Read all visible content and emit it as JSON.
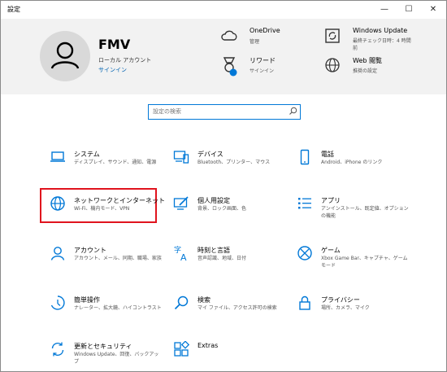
{
  "window": {
    "title": "設定",
    "minimize": "—",
    "maximize": "☐",
    "close": "✕"
  },
  "account": {
    "name": "FMV",
    "type": "ローカル アカウント",
    "signin": "サインイン"
  },
  "header_items": [
    {
      "name": "OneDrive",
      "desc": "管理",
      "icon": "cloud-icon"
    },
    {
      "name": "Windows Update",
      "desc": "最終チェック日時：4 時間前",
      "icon": "update-icon"
    },
    {
      "name": "リワード",
      "desc": "サインイン",
      "icon": "rewards-icon"
    },
    {
      "name": "Web 閲覧",
      "desc": "推奨の設定",
      "icon": "globe-icon"
    }
  ],
  "search": {
    "placeholder": "設定の検索"
  },
  "tiles": [
    {
      "name": "システム",
      "desc": "ディスプレイ、サウンド、通知、電源",
      "icon": "laptop-icon"
    },
    {
      "name": "デバイス",
      "desc": "Bluetooth、プリンター、マウス",
      "icon": "devices-icon"
    },
    {
      "name": "電話",
      "desc": "Android、iPhone のリンク",
      "icon": "phone-icon"
    },
    {
      "name": "ネットワークとインターネット",
      "desc": "Wi-Fi、機内モード、VPN",
      "icon": "globe-icon"
    },
    {
      "name": "個人用設定",
      "desc": "背景、ロック画面、色",
      "icon": "personalization-icon"
    },
    {
      "name": "アプリ",
      "desc": "アンインストール、既定値、オプションの機能",
      "icon": "apps-icon"
    },
    {
      "name": "アカウント",
      "desc": "アカウント、メール、同期、職場、家族",
      "icon": "person-icon"
    },
    {
      "name": "時刻と言語",
      "desc": "音声認識、地域、日付",
      "icon": "time-language-icon"
    },
    {
      "name": "ゲーム",
      "desc": "Xbox Game Bar、キャプチャ、ゲーム モード",
      "icon": "xbox-icon"
    },
    {
      "name": "簡単操作",
      "desc": "ナレーター、拡大鏡、ハイコントラスト",
      "icon": "ease-of-access-icon"
    },
    {
      "name": "検索",
      "desc": "マイ ファイル、アクセス許可の検索",
      "icon": "search-icon"
    },
    {
      "name": "プライバシー",
      "desc": "場所、カメラ、マイク",
      "icon": "lock-icon"
    },
    {
      "name": "更新とセキュリティ",
      "desc": "Windows Update、回復、バックアップ",
      "icon": "sync-icon"
    },
    {
      "name": "Extras",
      "desc": "",
      "icon": "extras-icon"
    }
  ],
  "colors": {
    "accent": "#0078d7",
    "highlight": "#e0141e",
    "header_bg": "#f2f2f2"
  }
}
